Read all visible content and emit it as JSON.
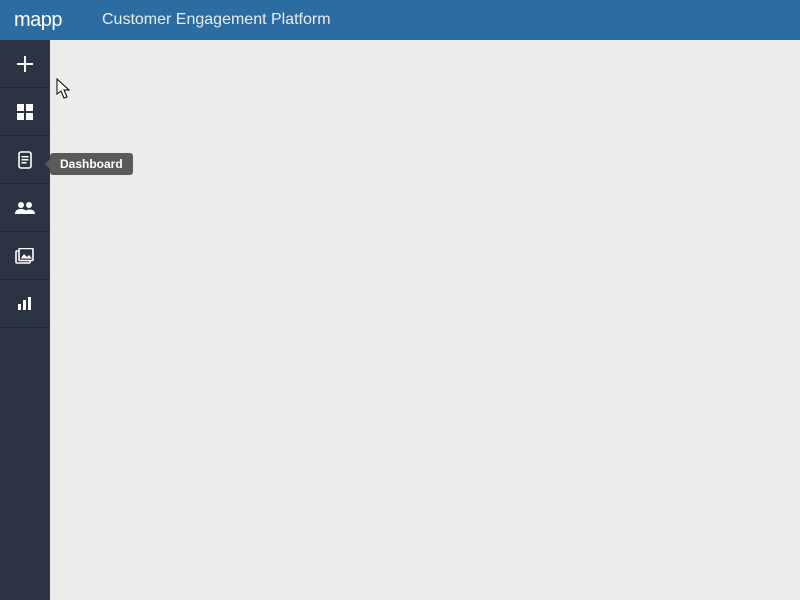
{
  "header": {
    "logo_text": "mapp",
    "app_title": "Customer Engagement Platform"
  },
  "sidebar": {
    "items": [
      {
        "name": "create",
        "icon": "plus-icon"
      },
      {
        "name": "dashboard",
        "icon": "dashboard-icon"
      },
      {
        "name": "content",
        "icon": "clipboard-icon"
      },
      {
        "name": "audience",
        "icon": "people-icon"
      },
      {
        "name": "media",
        "icon": "images-icon"
      },
      {
        "name": "analytics",
        "icon": "bar-chart-icon"
      }
    ]
  },
  "tooltip": {
    "label": "Dashboard"
  }
}
